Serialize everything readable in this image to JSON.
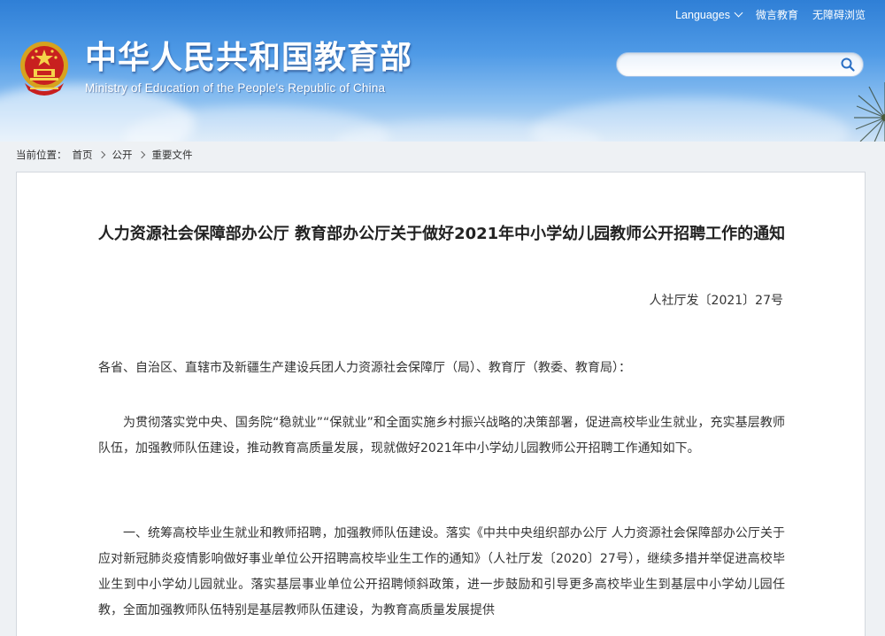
{
  "header": {
    "site_title": "中华人民共和国教育部",
    "site_subtitle": "Ministry of Education of the People's Republic of China",
    "toplinks": {
      "languages": "Languages",
      "weibo": "微言教育",
      "accessibility": "无障碍浏览"
    },
    "search": {
      "placeholder": "",
      "value": ""
    }
  },
  "breadcrumb": {
    "prefix": "当前位置：",
    "items": [
      "首页",
      "公开",
      "重要文件"
    ]
  },
  "article": {
    "title": "人力资源社会保障部办公厅 教育部办公厅关于做好2021年中小学幼儿园教师公开招聘工作的通知",
    "doc_number": "人社厅发〔2021〕27号",
    "salutation": "各省、自治区、直辖市及新疆生产建设兵团人力资源社会保障厅（局）、教育厅（教委、教育局）：",
    "paragraphs": [
      "为贯彻落实党中央、国务院“稳就业”“保就业”和全面实施乡村振兴战略的决策部署，促进高校毕业生就业，充实基层教师队伍，加强教师队伍建设，推动教育高质量发展，现就做好2021年中小学幼儿园教师公开招聘工作通知如下。",
      "一、统筹高校毕业生就业和教师招聘，加强教师队伍建设。落实《中共中央组织部办公厅 人力资源社会保障部办公厅关于应对新冠肺炎疫情影响做好事业单位公开招聘高校毕业生工作的通知》（人社厅发〔2020〕27号），继续多措并举促进高校毕业生到中小学幼儿园就业。落实基层事业单位公开招聘倾斜政策，进一步鼓励和引导更多高校毕业生到基层中小学幼儿园任教，全面加强教师队伍特别是基层教师队伍建设，为教育高质量发展提供"
    ]
  }
}
